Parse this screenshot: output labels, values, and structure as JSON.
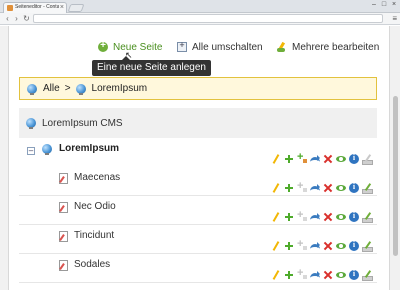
{
  "browser": {
    "tab_title": "Seiteneditor - Contao O...",
    "tab_close": "×",
    "url": "",
    "back": "‹",
    "forward": "›",
    "reload": "↻",
    "menu": "≡",
    "win_minimize": "–",
    "win_maximize": "□",
    "win_close": "×"
  },
  "toolbar": {
    "new_page": "Neue Seite",
    "toggle_all": "Alle umschalten",
    "edit_multiple": "Mehrere bearbeiten",
    "tooltip": "Eine neue Seite anlegen"
  },
  "breadcrumb": {
    "all": "Alle",
    "separator": ">",
    "current": "LoremIpsum"
  },
  "tree": {
    "cms": "LoremIpsum CMS",
    "root": {
      "label": "LoremIpsum",
      "toggle": "–"
    },
    "pages": [
      {
        "label": "Maecenas"
      },
      {
        "label": "Nec Odio"
      },
      {
        "label": "Tincidunt"
      },
      {
        "label": "Sodales"
      }
    ]
  },
  "colors": {
    "breadcrumb_bg": "#fff8dc",
    "breadcrumb_border": "#e2c23e",
    "tooltip_bg": "#333333",
    "accent_green": "#6fae3a"
  },
  "icons": {
    "actions": [
      "edit-icon",
      "add-after-icon",
      "add-into-icon",
      "move-icon",
      "delete-icon",
      "view-icon",
      "info-icon",
      "properties-icon"
    ]
  }
}
